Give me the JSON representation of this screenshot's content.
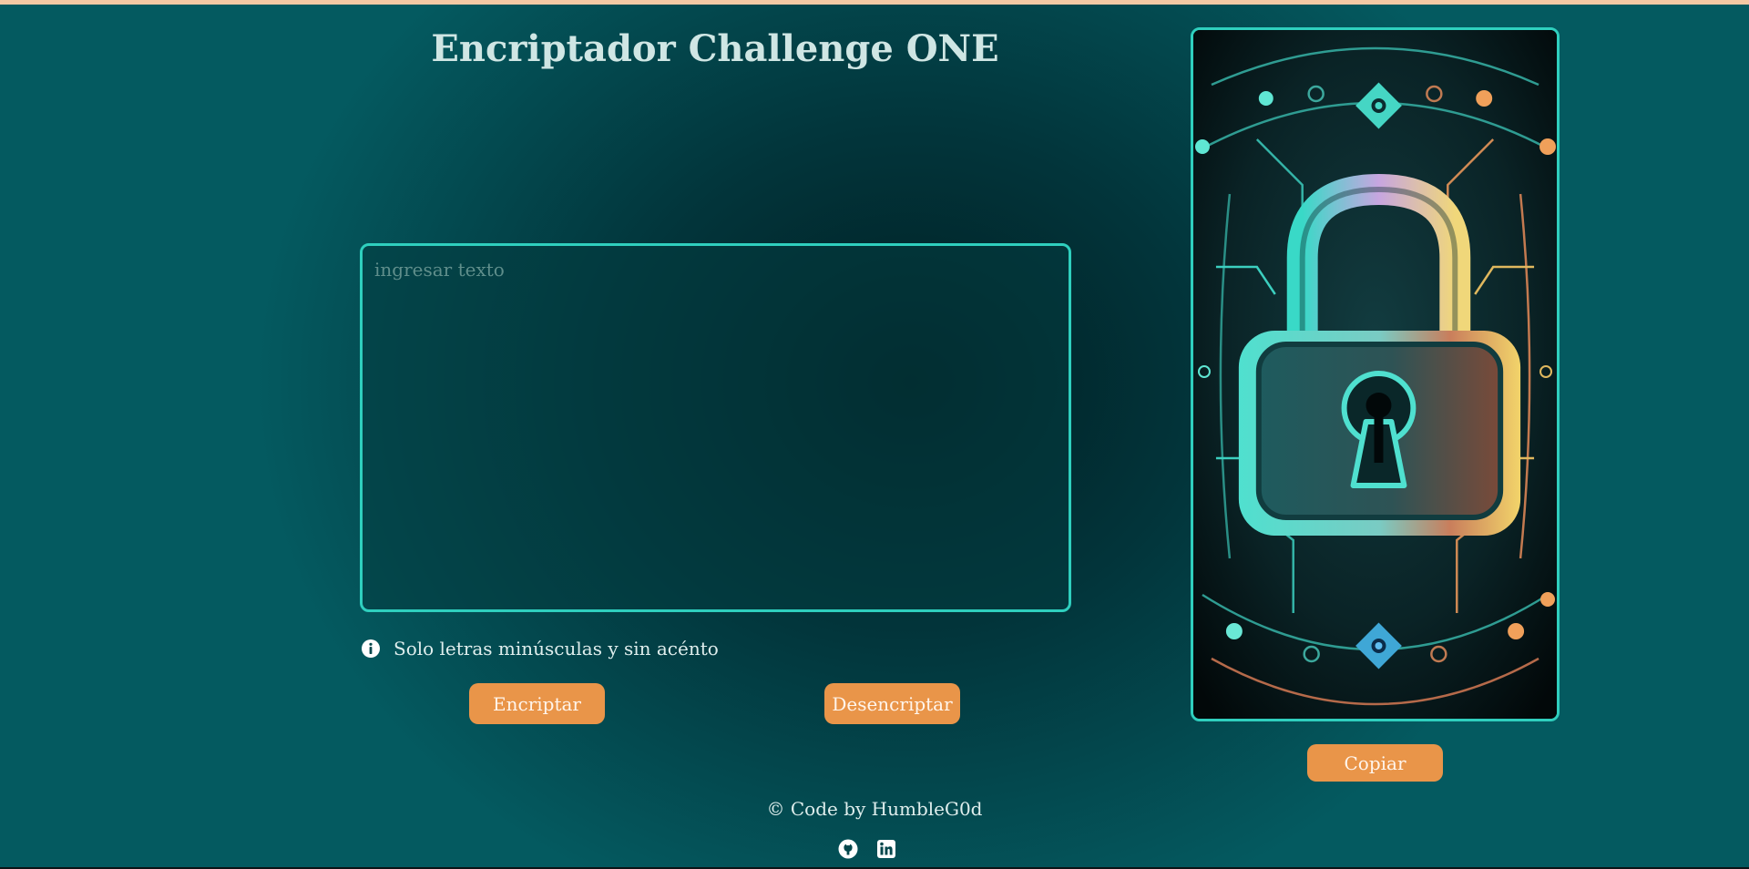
{
  "page": {
    "title": "Encriptador Challenge ONE"
  },
  "input": {
    "placeholder": "ingresar texto",
    "value": ""
  },
  "hint": {
    "icon": "info-icon",
    "text": "Solo letras minúsculas y sin acénto"
  },
  "actions": {
    "encrypt_label": "Encriptar",
    "decrypt_label": "Desencriptar"
  },
  "output": {
    "image_icon": "padlock-circuit-illustration",
    "copy_label": "Copiar"
  },
  "footer": {
    "credit": "© Code by HumbleG0d",
    "links": [
      {
        "icon": "github-icon"
      },
      {
        "icon": "linkedin-icon"
      }
    ]
  },
  "colors": {
    "accent": "#e99549",
    "border": "#2fcfbe",
    "background": "#045a60",
    "text": "#cfe6e4"
  }
}
